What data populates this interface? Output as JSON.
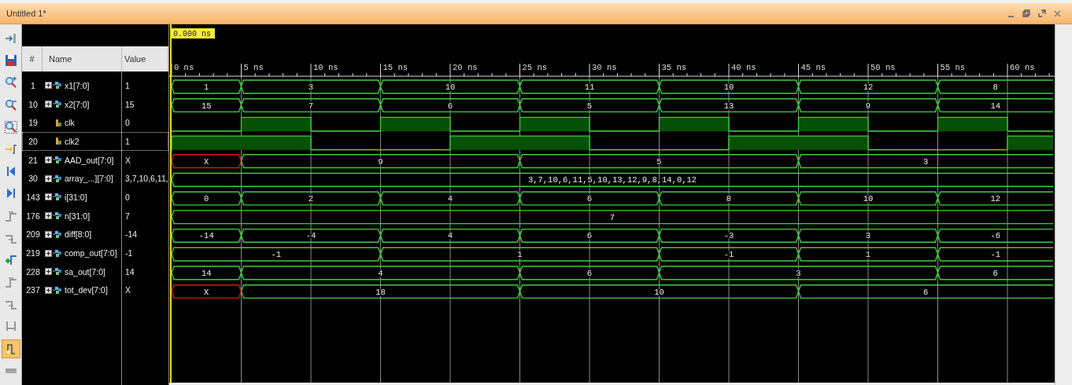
{
  "window": {
    "title": "Untitled 1*"
  },
  "toolbar": [
    {
      "kind": "import",
      "selected": false
    },
    {
      "kind": "save",
      "selected": false
    },
    {
      "kind": "zoom-in",
      "selected": false
    },
    {
      "kind": "zoom-out",
      "selected": false
    },
    {
      "kind": "zoom-fit",
      "selected": false
    },
    {
      "kind": "goto-cursor",
      "selected": false
    },
    {
      "kind": "goto-start",
      "selected": false
    },
    {
      "kind": "goto-end",
      "selected": false
    },
    {
      "kind": "prev-transition",
      "selected": false
    },
    {
      "kind": "next-transition",
      "selected": false
    },
    {
      "kind": "add-marker",
      "selected": false
    },
    {
      "kind": "prev-marker",
      "selected": false
    },
    {
      "kind": "next-marker",
      "selected": false
    },
    {
      "kind": "swap-cursors",
      "selected": false
    },
    {
      "kind": "snap",
      "selected": true
    },
    {
      "kind": "floating-ruler",
      "selected": false
    }
  ],
  "columns": [
    "#",
    "Name",
    "Value"
  ],
  "cursor": {
    "time": "0.000 ns"
  },
  "time_ticks": [
    "0 ns",
    "5 ns",
    "10 ns",
    "15 ns",
    "20 ns",
    "25 ns",
    "30 ns",
    "35 ns",
    "40 ns",
    "45 ns",
    "50 ns",
    "55 ns",
    "60 ns"
  ],
  "signals": [
    {
      "number": "1",
      "name": "x1[7:0]",
      "value": "1",
      "kind": "bus",
      "expanded": false,
      "selected": false,
      "segments": [
        {
          "label": "1",
          "unknown": false
        },
        {
          "label": "3",
          "unknown": false
        },
        {
          "label": "10",
          "unknown": false
        },
        {
          "label": "11",
          "unknown": false
        },
        {
          "label": "10",
          "unknown": false
        },
        {
          "label": "12",
          "unknown": false
        },
        {
          "label": "8",
          "unknown": false
        }
      ]
    },
    {
      "number": "10",
      "name": "x2[7:0]",
      "value": "15",
      "kind": "bus",
      "expanded": false,
      "selected": false,
      "segments": [
        {
          "label": "15",
          "unknown": false
        },
        {
          "label": "7",
          "unknown": false
        },
        {
          "label": "6",
          "unknown": false
        },
        {
          "label": "5",
          "unknown": false
        },
        {
          "label": "13",
          "unknown": false
        },
        {
          "label": "9",
          "unknown": false
        },
        {
          "label": "14",
          "unknown": false
        }
      ]
    },
    {
      "number": "19",
      "name": "clk",
      "value": "0",
      "kind": "bit",
      "selected": false,
      "segments": [
        {
          "high": false
        },
        {
          "high": true
        },
        {
          "high": false
        },
        {
          "high": true
        },
        {
          "high": false
        },
        {
          "high": true
        },
        {
          "high": false
        },
        {
          "high": true
        },
        {
          "high": false
        },
        {
          "high": true
        },
        {
          "high": false
        },
        {
          "high": true
        },
        {
          "high": false
        }
      ]
    },
    {
      "number": "20",
      "name": "clk2",
      "value": "1",
      "kind": "bit",
      "selected": true,
      "segments": [
        {
          "high": true
        },
        {
          "high": false
        },
        {
          "high": true
        },
        {
          "high": false
        },
        {
          "high": true
        },
        {
          "high": false
        },
        {
          "high": true
        }
      ]
    },
    {
      "number": "21",
      "name": "AAD_out[7:0]",
      "value": "X",
      "kind": "bus",
      "expanded": false,
      "selected": false,
      "segments": [
        {
          "label": "X",
          "unknown": true
        },
        {
          "label": "9",
          "unknown": false
        },
        {
          "label": "5",
          "unknown": false
        },
        {
          "label": "3",
          "unknown": false
        }
      ]
    },
    {
      "number": "30",
      "name": "array_...][7:0]",
      "value": "3,7,10,6,11,",
      "kind": "bus",
      "expanded": false,
      "selected": false,
      "segments": [
        {
          "label": "3,7,10,6,11,5,10,13,12,9,8,14,0,12",
          "unknown": false
        }
      ]
    },
    {
      "number": "143",
      "name": "i[31:0]",
      "value": "0",
      "kind": "bus",
      "expanded": false,
      "selected": false,
      "segments": [
        {
          "label": "0",
          "unknown": false
        },
        {
          "label": "2",
          "unknown": false
        },
        {
          "label": "4",
          "unknown": false
        },
        {
          "label": "6",
          "unknown": false
        },
        {
          "label": "8",
          "unknown": false
        },
        {
          "label": "10",
          "unknown": false
        },
        {
          "label": "12",
          "unknown": false
        }
      ]
    },
    {
      "number": "176",
      "name": "n[31:0]",
      "value": "7",
      "kind": "bus",
      "expanded": false,
      "selected": false,
      "segments": [
        {
          "label": "7",
          "unknown": false
        }
      ]
    },
    {
      "number": "209",
      "name": "diff[8:0]",
      "value": "-14",
      "kind": "bus",
      "expanded": false,
      "selected": false,
      "segments": [
        {
          "label": "-14",
          "unknown": false
        },
        {
          "label": "-4",
          "unknown": false
        },
        {
          "label": "4",
          "unknown": false
        },
        {
          "label": "6",
          "unknown": false
        },
        {
          "label": "-3",
          "unknown": false
        },
        {
          "label": "3",
          "unknown": false
        },
        {
          "label": "-6",
          "unknown": false
        }
      ]
    },
    {
      "number": "219",
      "name": "comp_out[7:0]",
      "value": "-1",
      "kind": "bus",
      "expanded": false,
      "selected": false,
      "segments": [
        {
          "label": "-1",
          "unknown": false
        },
        {
          "label": "1",
          "unknown": false
        },
        {
          "label": "-1",
          "unknown": false
        },
        {
          "label": "1",
          "unknown": false
        },
        {
          "label": "-1",
          "unknown": false
        }
      ]
    },
    {
      "number": "228",
      "name": "sa_out[7:0]",
      "value": "14",
      "kind": "bus",
      "expanded": false,
      "selected": false,
      "segments": [
        {
          "label": "14",
          "unknown": false
        },
        {
          "label": "4",
          "unknown": false
        },
        {
          "label": "6",
          "unknown": false
        },
        {
          "label": "3",
          "unknown": false
        },
        {
          "label": "6",
          "unknown": false
        }
      ]
    },
    {
      "number": "237",
      "name": "tot_dev[7:0]",
      "value": "X",
      "kind": "bus",
      "expanded": false,
      "selected": false,
      "segments": [
        {
          "label": "X",
          "unknown": true
        },
        {
          "label": "18",
          "unknown": false
        },
        {
          "label": "10",
          "unknown": false
        },
        {
          "label": "6",
          "unknown": false
        }
      ]
    }
  ]
}
